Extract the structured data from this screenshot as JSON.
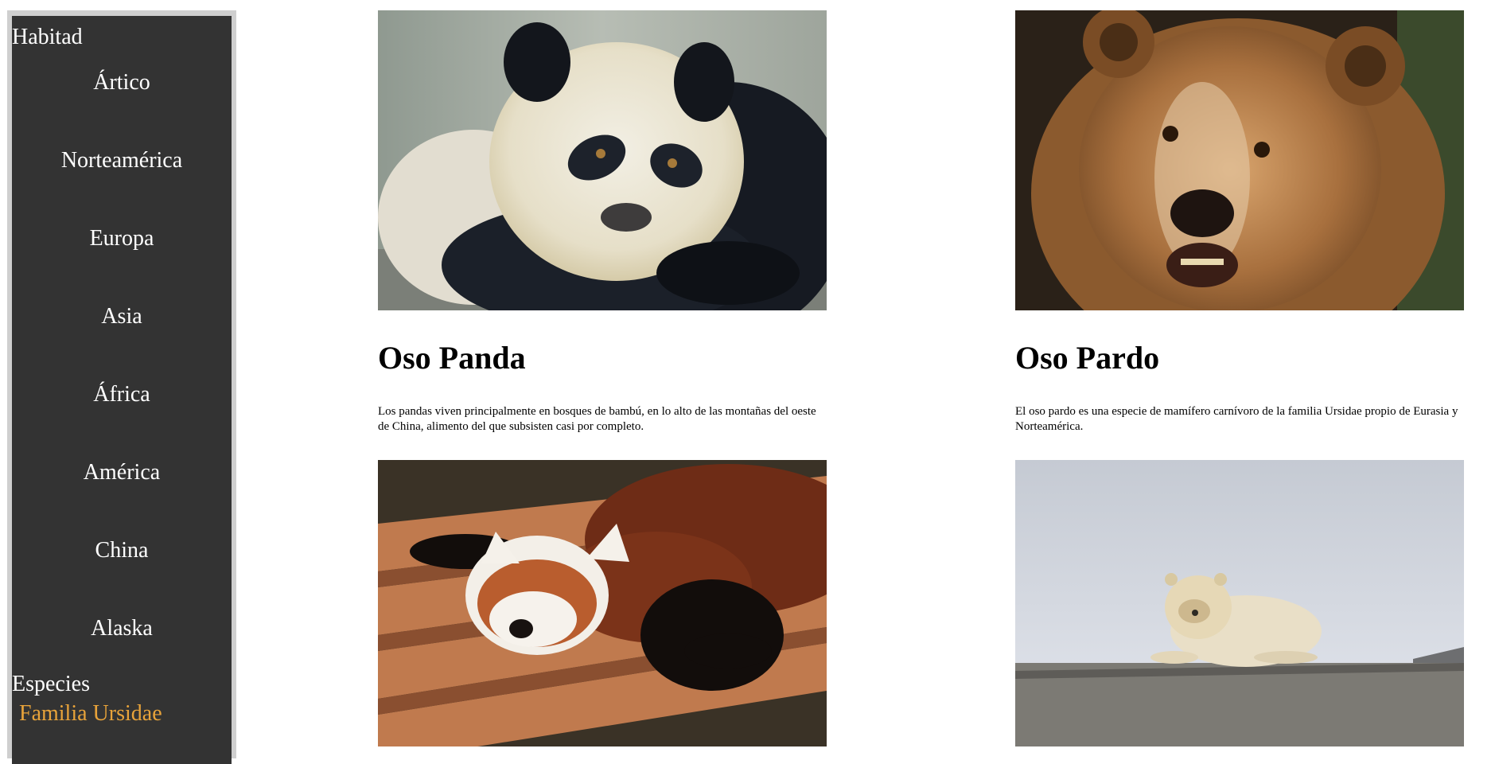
{
  "sidebar": {
    "habitat_heading": "Habitad",
    "habitats": [
      {
        "label": "Ártico"
      },
      {
        "label": "Norteamérica"
      },
      {
        "label": "Europa"
      },
      {
        "label": "Asia"
      },
      {
        "label": "África"
      },
      {
        "label": "América"
      },
      {
        "label": "China"
      },
      {
        "label": "Alaska"
      }
    ],
    "species_heading": "Especies",
    "family_link": "Familia Ursidae"
  },
  "cards": [
    {
      "image": "giant-panda-photo",
      "title": "Oso Panda",
      "text": "Los pandas viven principalmente en bosques de bambú, en lo alto de las montañas del oeste de China, alimento del que subsisten casi por completo."
    },
    {
      "image": "brown-bear-photo",
      "title": "Oso Pardo",
      "text": "El oso pardo es una especie de mamífero carnívoro de la familia Ursidae propio de Eurasia y Norteamérica."
    },
    {
      "image": "red-panda-photo"
    },
    {
      "image": "polar-bear-photo"
    }
  ],
  "colors": {
    "sidebar_bg": "#333333",
    "sidebar_frame": "#cfcfcf",
    "family_link": "#e8a33a"
  }
}
